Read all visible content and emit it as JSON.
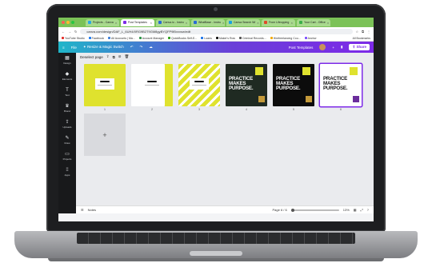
{
  "browser": {
    "tabs": [
      {
        "label": "Projects - Canva",
        "favicon": "#2aa8e6"
      },
      {
        "label": "Post Templates",
        "favicon": "#7d2ae8",
        "active": true
      },
      {
        "label": "Canva.io - Instru",
        "favicon": "#2a6bd6"
      },
      {
        "label": "WhatBase - Instru",
        "favicon": "#2a6bd6"
      },
      {
        "label": "Canva Search Wi",
        "favicon": "#1aa3e0"
      },
      {
        "label": "From Lifeopping",
        "favicon": "#e04a2a"
      },
      {
        "label": "Your Cart - Office",
        "favicon": "#3cb04a"
      }
    ],
    "url": "canva.com/design/DAF_L_6UH4/0RG9B2T9GM8gyBYQFP9lBxxxsw/edit",
    "bookmarks": [
      {
        "label": "YouTube Studio",
        "color": "#e52d27"
      },
      {
        "label": "Facebook",
        "color": "#1877f2"
      },
      {
        "label": "All Accounts | Ma...",
        "color": "#3b7dd8"
      },
      {
        "label": "Account Manager",
        "color": "#2b9348"
      },
      {
        "label": "QuickBooks Self-E...",
        "color": "#2ca01c"
      },
      {
        "label": "Loans",
        "color": "#1a73e8"
      },
      {
        "label": "Maker's Row",
        "color": "#111111"
      },
      {
        "label": "Criminal Records...",
        "color": "#555555"
      },
      {
        "label": "Hirefreelancing Cou...",
        "color": "#f2a900"
      },
      {
        "label": "Anchor",
        "color": "#7c4dff"
      }
    ],
    "all_bookmarks": "All Bookmarks"
  },
  "canva": {
    "file_label": "File",
    "resize_label": "Resize & Magic Switch",
    "project_title": "Post Templates",
    "share_label": "Share",
    "page_label": "Deselect page",
    "rail": [
      {
        "label": "Design",
        "glyph": "▦"
      },
      {
        "label": "Elements",
        "glyph": "◆"
      },
      {
        "label": "Text",
        "glyph": "T"
      },
      {
        "label": "Brand",
        "glyph": "♛"
      },
      {
        "label": "Uploads",
        "glyph": "⇪"
      },
      {
        "label": "Draw",
        "glyph": "✎"
      },
      {
        "label": "Projects",
        "glyph": "▭"
      },
      {
        "label": "Apps",
        "glyph": "⁞⁞"
      }
    ],
    "pages": [
      {
        "num": "1",
        "style": "yellow"
      },
      {
        "num": "2",
        "style": "white"
      },
      {
        "num": "3",
        "style": "stripes"
      },
      {
        "num": "4",
        "style": "dark-green"
      },
      {
        "num": "5",
        "style": "black"
      },
      {
        "num": "6",
        "style": "white-purple",
        "selected": true
      }
    ],
    "headline": "PRACTICE\nMAKES\nPURPOSE.",
    "add_page_glyph": "+",
    "notes_label": "Notes",
    "page_counter": "Page 6 / 6",
    "zoom": "13%",
    "colors": {
      "accent": "#7d2ae8",
      "yellow": "#dfe22e",
      "rail": "#18191b"
    }
  }
}
